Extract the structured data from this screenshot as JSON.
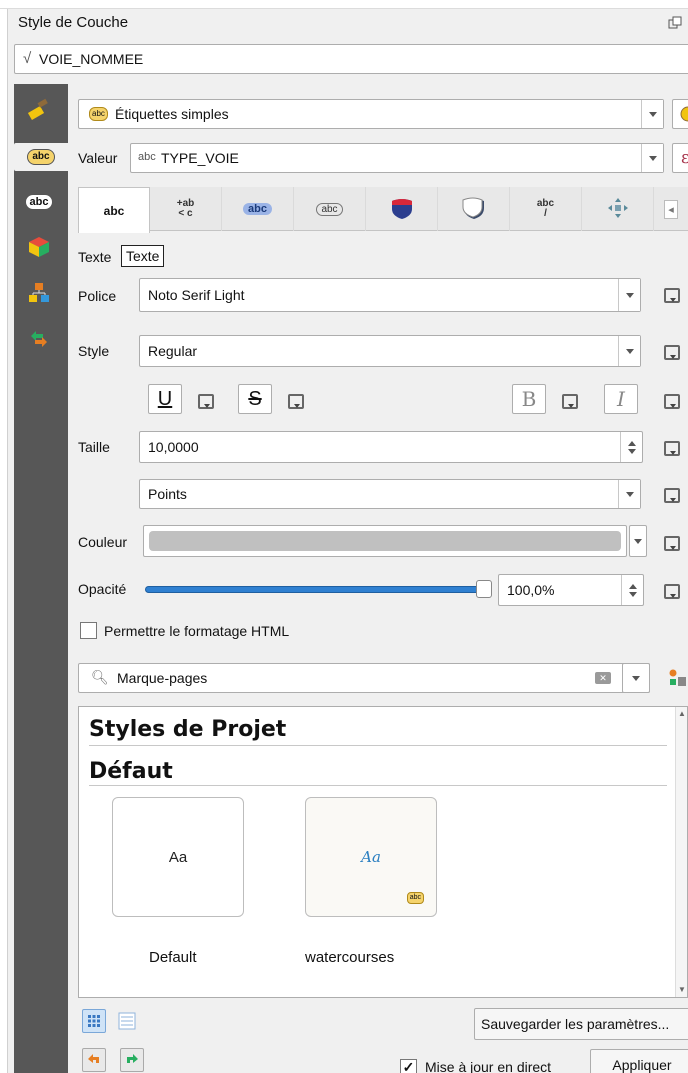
{
  "panel": {
    "title": "Style de Couche"
  },
  "layer": {
    "name": "VOIE_NOMMEE"
  },
  "renderer": {
    "selected": "Étiquettes simples"
  },
  "value": {
    "label": "Valeur",
    "prefix": "abc",
    "field": "TYPE_VOIE"
  },
  "tabs": [
    {
      "id": "text",
      "glyph": "abc"
    },
    {
      "id": "formatting",
      "glyph": "+ab\n< c"
    },
    {
      "id": "buffer",
      "glyph": "abc"
    },
    {
      "id": "mask",
      "glyph": "abc"
    },
    {
      "id": "background",
      "glyph": ""
    },
    {
      "id": "shadow",
      "glyph": ""
    },
    {
      "id": "callouts",
      "glyph": "abc"
    },
    {
      "id": "placement",
      "glyph": ""
    }
  ],
  "text_section": {
    "label": "Texte",
    "tooltip": "Texte"
  },
  "font": {
    "label": "Police",
    "value": "Noto Serif Light"
  },
  "style": {
    "label": "Style",
    "value": "Regular"
  },
  "format_buttons": {
    "underline": "U",
    "strike": "S",
    "bold": "B",
    "italic": "I"
  },
  "size": {
    "label": "Taille",
    "value": "10,0000",
    "unit": "Points"
  },
  "color": {
    "label": "Couleur",
    "swatch": "#c0c0c0"
  },
  "opacity": {
    "label": "Opacité",
    "value": "100,0%",
    "level": 1.0
  },
  "html_formatting": {
    "label": "Permettre le formatage HTML",
    "checked": false
  },
  "library": {
    "search_placeholder": "Marque-pages",
    "project_styles": "Styles de Projet",
    "default_group": "Défaut",
    "styles": [
      {
        "name": "Default",
        "preview": "Aa"
      },
      {
        "name": "watercourses",
        "preview": "Aa",
        "badge": "abc"
      }
    ]
  },
  "footer": {
    "save_button": "Sauvegarder les paramètres...",
    "live_update": {
      "label": "Mise à jour en direct",
      "checked": true
    },
    "apply_button": "Appliquer"
  },
  "colors": {
    "accent": "#2f80d1",
    "sidebar": "#575757"
  }
}
